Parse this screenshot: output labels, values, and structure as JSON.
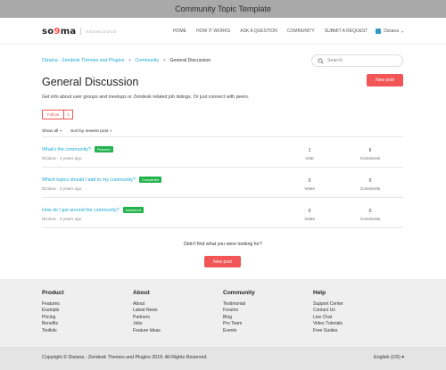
{
  "window": {
    "title": "Community Topic Template"
  },
  "brand": {
    "name": "so9ma",
    "subtitle": "KNOWLEDGE"
  },
  "nav": {
    "items": [
      "HOME",
      "HOW IT WORKS",
      "ASK A QUESTION",
      "COMMUNITY",
      "SUBMIT A REQUEST"
    ],
    "user": "Diziana"
  },
  "breadcrumb": {
    "items": [
      "Diziana - Zendesk Themes and Plugins",
      "Community"
    ],
    "current": "General Discussion",
    "separator": ">"
  },
  "search": {
    "placeholder": "Search",
    "value": ""
  },
  "topic": {
    "title": "General Discussion",
    "new_post_label": "New post",
    "description": "Get info about user groups and meetups or Zendesk related job listings. Or just connect with peers.",
    "follow_label": "Follow",
    "follow_count": "1"
  },
  "filters": {
    "show": "Show all",
    "sort": "Sort by newest post",
    "caret": "▾"
  },
  "posts": [
    {
      "title": "What's the community?",
      "badge": "Planned",
      "author": "Diziana",
      "age": "3 years ago",
      "votes": "1",
      "votes_label": "Vote",
      "comments": "6",
      "comments_label": "Comments"
    },
    {
      "title": "Which topics should I add to my community?",
      "badge": "Completed",
      "author": "Diziana",
      "age": "3 years ago",
      "votes": "0",
      "votes_label": "Votes",
      "comments": "0",
      "comments_label": "Comments"
    },
    {
      "title": "How do I get around the community?",
      "badge": "answered",
      "author": "Diziana",
      "age": "3 years ago",
      "votes": "0",
      "votes_label": "Votes",
      "comments": "0",
      "comments_label": "Comments"
    }
  ],
  "not_found": {
    "text": "Didn't find what you were looking for?",
    "button": "New post"
  },
  "footer": {
    "columns": [
      {
        "heading": "Product",
        "links": [
          "Features",
          "Example",
          "Pricing",
          "Benefits",
          "Toolkits"
        ]
      },
      {
        "heading": "About",
        "links": [
          "About",
          "Latest News",
          "Partners",
          "Jobs",
          "Feature Ideas"
        ]
      },
      {
        "heading": "Community",
        "links": [
          "Testimonial",
          "Forums",
          "Blog",
          "Pro Team",
          "Events"
        ]
      },
      {
        "heading": "Help",
        "links": [
          "Support Center",
          "Contact Us",
          "Live Chat",
          "Video Tutorials",
          "Free Guides"
        ]
      }
    ],
    "copyright": "Copyright © Diziana - Zendesk Themes and Plugins 2019. All Rights Reserved.",
    "language": "English (US)",
    "language_caret": "▾"
  },
  "colors": {
    "accent": "#f25555",
    "link": "#1aa9d4",
    "badge": "#22b24c"
  }
}
